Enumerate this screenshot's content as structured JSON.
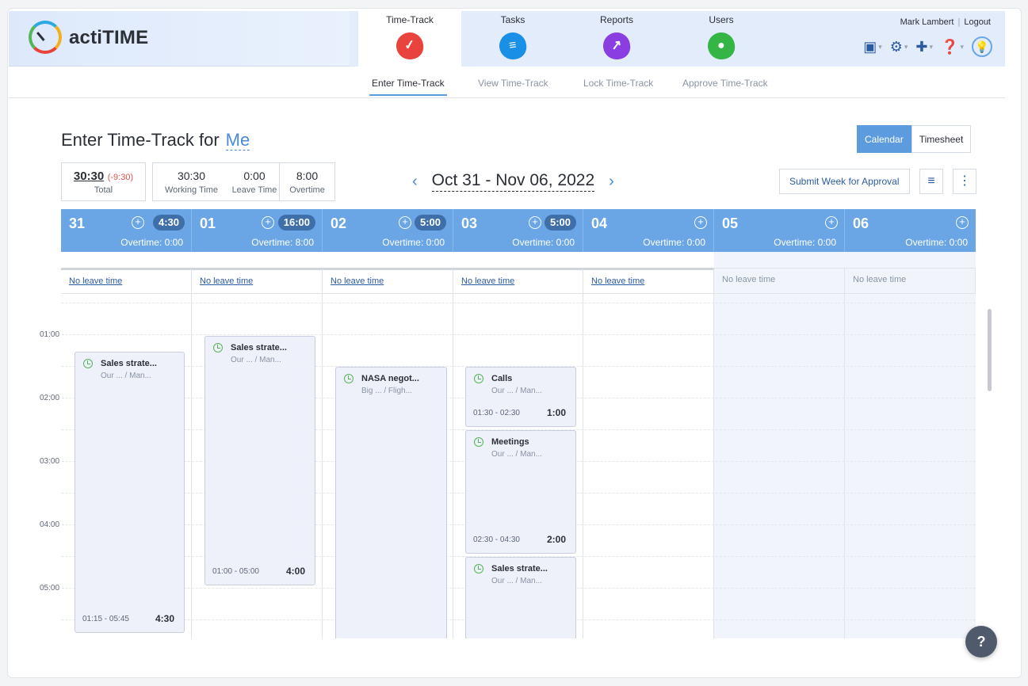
{
  "app": {
    "logo_text": "actiTIME"
  },
  "modules": [
    {
      "label": "Time-Track",
      "icon": "check-icon",
      "color": "#e8433d"
    },
    {
      "label": "Tasks",
      "icon": "list-icon",
      "color": "#1a8fe6"
    },
    {
      "label": "Reports",
      "icon": "chart-icon",
      "color": "#8a3de0"
    },
    {
      "label": "Users",
      "icon": "user-icon",
      "color": "#34b545"
    }
  ],
  "user": {
    "name": "Mark Lambert",
    "logout": "Logout"
  },
  "subtabs": [
    "Enter Time-Track",
    "View Time-Track",
    "Lock Time-Track",
    "Approve Time-Track"
  ],
  "page": {
    "title": "Enter Time-Track for",
    "for_user": "Me",
    "view_options": [
      "Calendar",
      "Timesheet"
    ],
    "active_view": "Calendar"
  },
  "summary": {
    "total": "30:30",
    "difference": "(-9:30)",
    "total_caption": "Total",
    "working_time": "30:30",
    "working_caption": "Working Time",
    "leave_time": "0:00",
    "leave_caption": "Leave Time",
    "overtime": "8:00",
    "overtime_caption": "Overtime"
  },
  "week": {
    "range": "Oct 31 - Nov 06, 2022",
    "prev": "‹",
    "next": "›",
    "submit_label": "Submit Week for Approval"
  },
  "days": [
    {
      "num": "31",
      "total": "4:30",
      "overtime_label": "Overtime:",
      "overtime": "0:00",
      "leave": "No leave time"
    },
    {
      "num": "01",
      "total": "16:00",
      "overtime_label": "Overtime:",
      "overtime": "8:00",
      "leave": "No leave time"
    },
    {
      "num": "02",
      "total": "5:00",
      "overtime_label": "Overtime:",
      "overtime": "0:00",
      "leave": "No leave time"
    },
    {
      "num": "03",
      "total": "5:00",
      "overtime_label": "Overtime:",
      "overtime": "0:00",
      "leave": "No leave time"
    },
    {
      "num": "04",
      "total": "",
      "overtime_label": "Overtime:",
      "overtime": "0:00",
      "leave": "No leave time"
    },
    {
      "num": "05",
      "total": "",
      "overtime_label": "Overtime:",
      "overtime": "0:00",
      "leave": "No leave time"
    },
    {
      "num": "06",
      "total": "",
      "overtime_label": "Overtime:",
      "overtime": "0:00",
      "leave": "No leave time"
    }
  ],
  "hours": [
    "01:00",
    "02:00",
    "03:00",
    "04:00",
    "05:00"
  ],
  "entries": [
    {
      "task": "Sales strate...",
      "project": "Our ...  / Man...",
      "span": "01:15 - 05:45",
      "duration": "4:30"
    },
    {
      "task": "Sales strate...",
      "project": "Our ...  / Man...",
      "span": "01:00 - 05:00",
      "duration": "4:00"
    },
    {
      "task": "NASA negot...",
      "project": "Big ...  / Fligh...",
      "span": "",
      "duration": ""
    },
    {
      "task": "Calls",
      "project": "Our ...  / Man...",
      "span": "01:30 - 02:30",
      "duration": "1:00"
    },
    {
      "task": "Meetings",
      "project": "Our ...  / Man...",
      "span": "02:30 - 04:30",
      "duration": "2:00"
    },
    {
      "task": "Sales strate...",
      "project": "Our ...  / Man...",
      "span": "",
      "duration": ""
    }
  ],
  "help": "?"
}
